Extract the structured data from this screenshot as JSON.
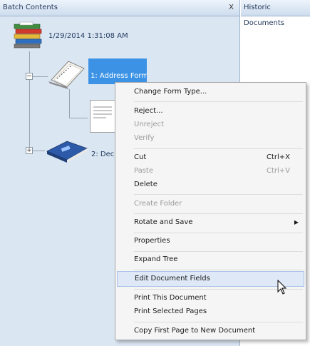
{
  "batch_panel": {
    "title": "Batch Contents",
    "close_label": "X",
    "root_label": "1/29/2014 1:31:08 AM",
    "doc1_label": "1: Address Form",
    "doc2_label": "2: Dec"
  },
  "historic_panel": {
    "title": "Historic Documents"
  },
  "context_menu": {
    "change_form_type": "Change Form Type...",
    "reject": "Reject...",
    "unreject": "Unreject",
    "verify": "Verify",
    "cut": "Cut",
    "cut_shortcut": "Ctrl+X",
    "paste": "Paste",
    "paste_shortcut": "Ctrl+V",
    "delete": "Delete",
    "create_folder": "Create Folder",
    "rotate_and_save": "Rotate and Save",
    "properties": "Properties",
    "expand_tree": "Expand Tree",
    "edit_document_fields": "Edit Document Fields",
    "print_this_document": "Print This Document",
    "print_selected_pages": "Print Selected Pages",
    "copy_first_page": "Copy First Page to New Document"
  },
  "colors": {
    "panel_bg": "#dbe6f3",
    "selection": "#3c93e6",
    "menu_bg": "#f5f5f5",
    "menu_hover": "#dfe8f6"
  }
}
